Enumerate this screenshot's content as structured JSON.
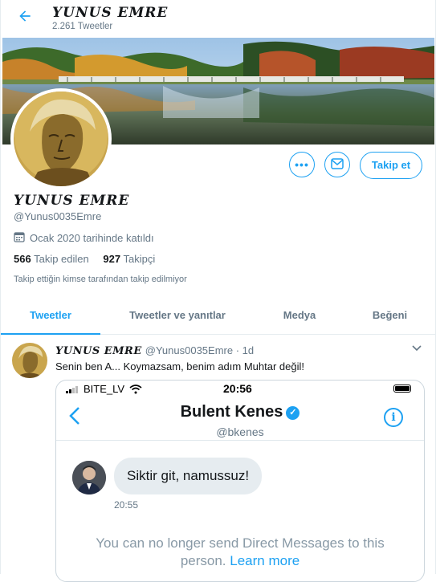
{
  "header": {
    "title": "YUNUS EMRE",
    "tweet_count": "2.261 Tweetler"
  },
  "profile": {
    "name": "YUNUS EMRE",
    "handle": "@Yunus0035Emre",
    "joined": "Ocak 2020 tarihinde katıldı",
    "following_count": "566",
    "following_label": "Takip edilen",
    "followers_count": "927",
    "followers_label": "Takipçi",
    "followers_you_know": "Takip ettiğin kimse tarafından takip edilmiyor"
  },
  "actions": {
    "more_icon": "more-icon",
    "message_icon": "envelope-icon",
    "follow_label": "Takip et"
  },
  "tabs": [
    {
      "label": "Tweetler",
      "active": true
    },
    {
      "label": "Tweetler ve yanıtlar",
      "active": false
    },
    {
      "label": "Medya",
      "active": false
    },
    {
      "label": "Beğeni",
      "active": false
    }
  ],
  "tweet": {
    "author_name": "YUNUS EMRE",
    "author_meta": "@Yunus0035Emre · 1d",
    "text": "Senin ben A... Koymazsam, benim adım Muhtar değil!",
    "screenshot": {
      "carrier": "BITE_LV",
      "clock": "20:56",
      "dm_name": "Bulent Kenes",
      "dm_handle": "@bkenes",
      "message": "Siktir git, namussuz!",
      "message_time": "20:55",
      "notice": "You can no longer send Direct Messages to this person.",
      "learn_more": "Learn more"
    }
  },
  "colors": {
    "accent": "#1da1f2",
    "muted": "#657786"
  }
}
